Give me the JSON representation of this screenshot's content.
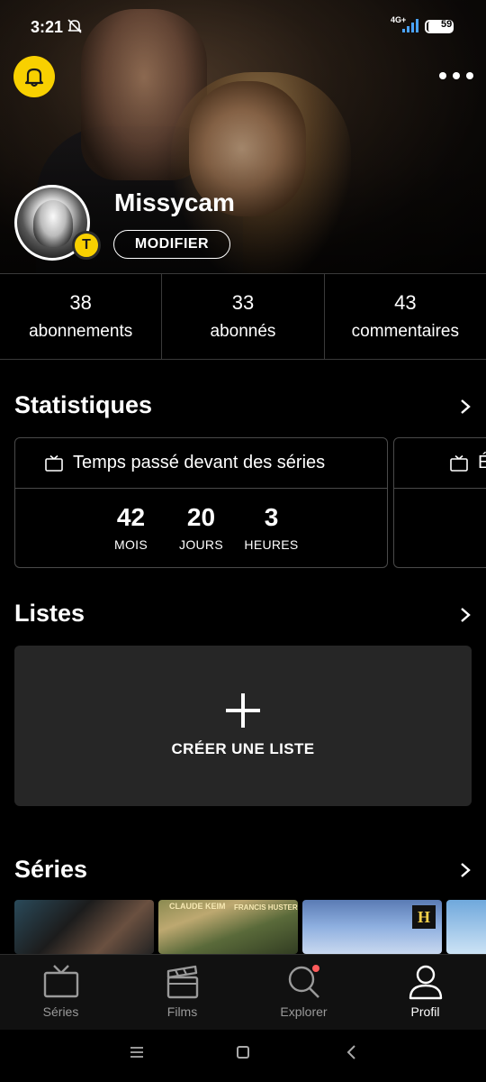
{
  "status_bar": {
    "time": "3:21",
    "network": "4G+",
    "battery": "59"
  },
  "profile": {
    "username": "Missycam",
    "edit_label": "MODIFIER",
    "badge_letter": "T",
    "accent_color": "#f8d000"
  },
  "counts": [
    {
      "value": "38",
      "label": "abonnements"
    },
    {
      "value": "33",
      "label": "abonnés"
    },
    {
      "value": "43",
      "label": "commentaires"
    }
  ],
  "statistics": {
    "title": "Statistiques",
    "card_title": "Temps passé devant des séries",
    "card2_title_partial": "É",
    "values": [
      {
        "number": "42",
        "unit": "MOIS"
      },
      {
        "number": "20",
        "unit": "JOURS"
      },
      {
        "number": "3",
        "unit": "HEURES"
      }
    ]
  },
  "lists": {
    "title": "Listes",
    "create_label": "CRÉER UNE LISTE"
  },
  "series": {
    "title": "Séries",
    "poster2_text_left": "CLAUDE KEIM",
    "poster2_text_right": "FRANCIS HUSTER",
    "poster3_logo": "H"
  },
  "nav": [
    {
      "label": "Séries",
      "icon": "tv-icon",
      "active": false
    },
    {
      "label": "Films",
      "icon": "clapperboard-icon",
      "active": false
    },
    {
      "label": "Explorer",
      "icon": "search-icon",
      "active": false
    },
    {
      "label": "Profil",
      "icon": "user-icon",
      "active": true
    }
  ]
}
